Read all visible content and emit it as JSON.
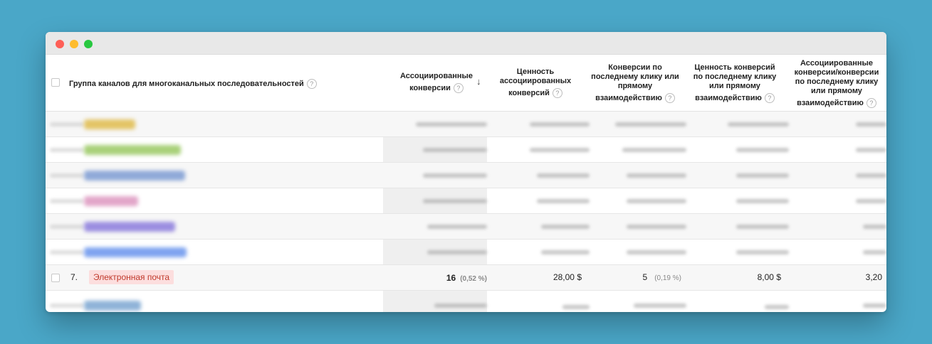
{
  "table": {
    "headers": {
      "group": "Группа каналов для многоканальных последовательностей",
      "assisted_l1": "Ассоциированные",
      "assisted_l2": "конверсии",
      "assisted_value_l1": "Ценность",
      "assisted_value_l2": "ассоциированных",
      "assisted_value_l3": "конверсий",
      "last_click_l1": "Конверсии по",
      "last_click_l2": "последнему клику или",
      "last_click_l3": "прямому",
      "last_click_l4": "взаимодействию",
      "last_click_value_l1": "Ценность конверсий",
      "last_click_value_l2": "по последнему клику",
      "last_click_value_l3": "или прямому",
      "last_click_value_l4": "взаимодействию",
      "ratio_l1": "Ассоциированные",
      "ratio_l2": "конверсии/конверсии",
      "ratio_l3": "по последнему клику",
      "ratio_l4": "или прямому",
      "ratio_l5": "взаимодействию",
      "help_glyph": "?",
      "sort_glyph": "↓"
    },
    "visible_row": {
      "index": "7.",
      "channel": "Электронная почта",
      "assisted_conversions": "16",
      "assisted_conversions_pct": "(0,52 %)",
      "assisted_value": "28,00 $",
      "last_click_conversions": "5",
      "last_click_conversions_pct": "(0,19 %)",
      "last_click_value": "8,00 $",
      "ratio": "3,20"
    },
    "blurred_chip_colors": [
      "#e3c466",
      "#a9d17a",
      "#8fa9d8",
      "#e2a6c9",
      "#9b8ee0",
      "#7fa4f0",
      "#8fb3d8"
    ]
  }
}
